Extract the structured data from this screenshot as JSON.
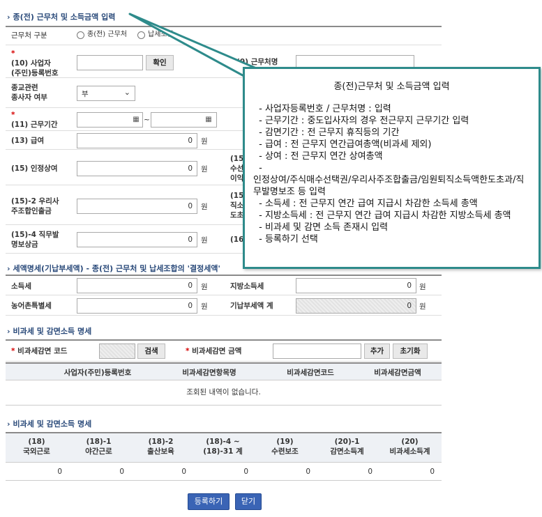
{
  "section1": {
    "title": "종(전) 근무처 및 소득금액 입력"
  },
  "workplace_type": {
    "label": "근무처 구분",
    "option1": "종(전) 근무처",
    "option2": "납세조합"
  },
  "biz_number": {
    "label_line1": "(10) 사업자",
    "label_line2": "(주민)등록번호",
    "value": "",
    "button": "확인"
  },
  "workplace_name": {
    "label": "(9) 근무처명",
    "value": ""
  },
  "religious": {
    "label_line1": "종교관련",
    "label_line2": "종사자 여부",
    "selected": "부"
  },
  "work_period": {
    "label": "(11) 근무기간",
    "tilde": "~"
  },
  "salary": {
    "label": "(13) 급여",
    "value": "0",
    "unit": "원"
  },
  "bonus": {
    "label": "(15) 인정상여",
    "value": "0",
    "unit": "원",
    "right_label_line1": "(15",
    "right_label_line2": "수선",
    "right_label_line3": "이익"
  },
  "esop": {
    "label_line1": "(15)-2 우리사",
    "label_line2": "주조합인출금",
    "value": "0",
    "unit": "원",
    "right_label_line1": "(15",
    "right_label_line2": "직소",
    "right_label_line3": "도초"
  },
  "invention": {
    "label_line1": "(15)-4 직무발",
    "label_line2": "명보상금",
    "value": "0",
    "unit": "원",
    "right_label": "(16"
  },
  "section2": {
    "title": "세액명세(기납부세액) - 종(전) 근무처 및 납세조합의 '결정세액'"
  },
  "income_tax": {
    "label": "소득세",
    "value": "0",
    "unit": "원"
  },
  "local_tax": {
    "label": "지방소득세",
    "value": "0",
    "unit": "원"
  },
  "rural_tax": {
    "label": "농어촌특별세",
    "value": "0",
    "unit": "원"
  },
  "prepaid_total": {
    "label": "기납부세액 계",
    "value": "0",
    "unit": "원"
  },
  "section3": {
    "title": "비과세 및 감면소득 명세",
    "code_label": "비과세감면 코드",
    "search_button": "검색",
    "amount_label": "비과세감면 금액",
    "add_button": "추가",
    "reset_button": "초기화",
    "columns": [
      "사업자(주민)등록번호",
      "비과세감면항목명",
      "비과세감면코드",
      "비과세감면금액"
    ],
    "empty_message": "조회된 내역이 없습니다."
  },
  "section4": {
    "title": "비과세 및 감면소득 명세",
    "columns": [
      {
        "line1": "(18)",
        "line2": "국외근로"
      },
      {
        "line1": "(18)-1",
        "line2": "야간근로"
      },
      {
        "line1": "(18)-2",
        "line2": "출산보육"
      },
      {
        "line1": "(18)-4 ~",
        "line2": "(18)-31 계"
      },
      {
        "line1": "(19)",
        "line2": "수련보조"
      },
      {
        "line1": "(20)-1",
        "line2": "감면소득계"
      },
      {
        "line1": "(20)",
        "line2": "비과세소득계"
      }
    ],
    "values": [
      "0",
      "0",
      "0",
      "0",
      "0",
      "0",
      "0"
    ]
  },
  "buttons": {
    "register": "등록하기",
    "close": "닫기"
  },
  "callout": {
    "title": "종(전)근무처 및 소득금액 입력",
    "lines": [
      " - 사업자등록번호 / 근무처명 : 입력",
      " - 근무기간 : 중도입사자의 경우 전근무지 근무기간 입력",
      " - 감면기간 : 전 근무지 휴직등의 기간",
      " - 급여 : 전 근무지 연간급여총액(비과세 제외)",
      " - 상여 : 전 근무지 연간 상여총액",
      " -",
      "인정상여/주식매수선택권/우리사주조합출금/임원퇴직소득액한도초과/직무발명보조 등 입력",
      " - 소득세 : 전 근무지 연간 급여 지급시 차감한 소득세 총액",
      " - 지방소득세 : 전 근무지 연간 급여 지급시 차감한 지방소득세 총액",
      " - 비과세 및 감면 소득 존재시 입력",
      " - 등록하기 선택"
    ]
  },
  "colors": {
    "accent": "#2a4a7a",
    "callout_border": "#2e8b8b",
    "button_blue": "#3a64b5"
  }
}
